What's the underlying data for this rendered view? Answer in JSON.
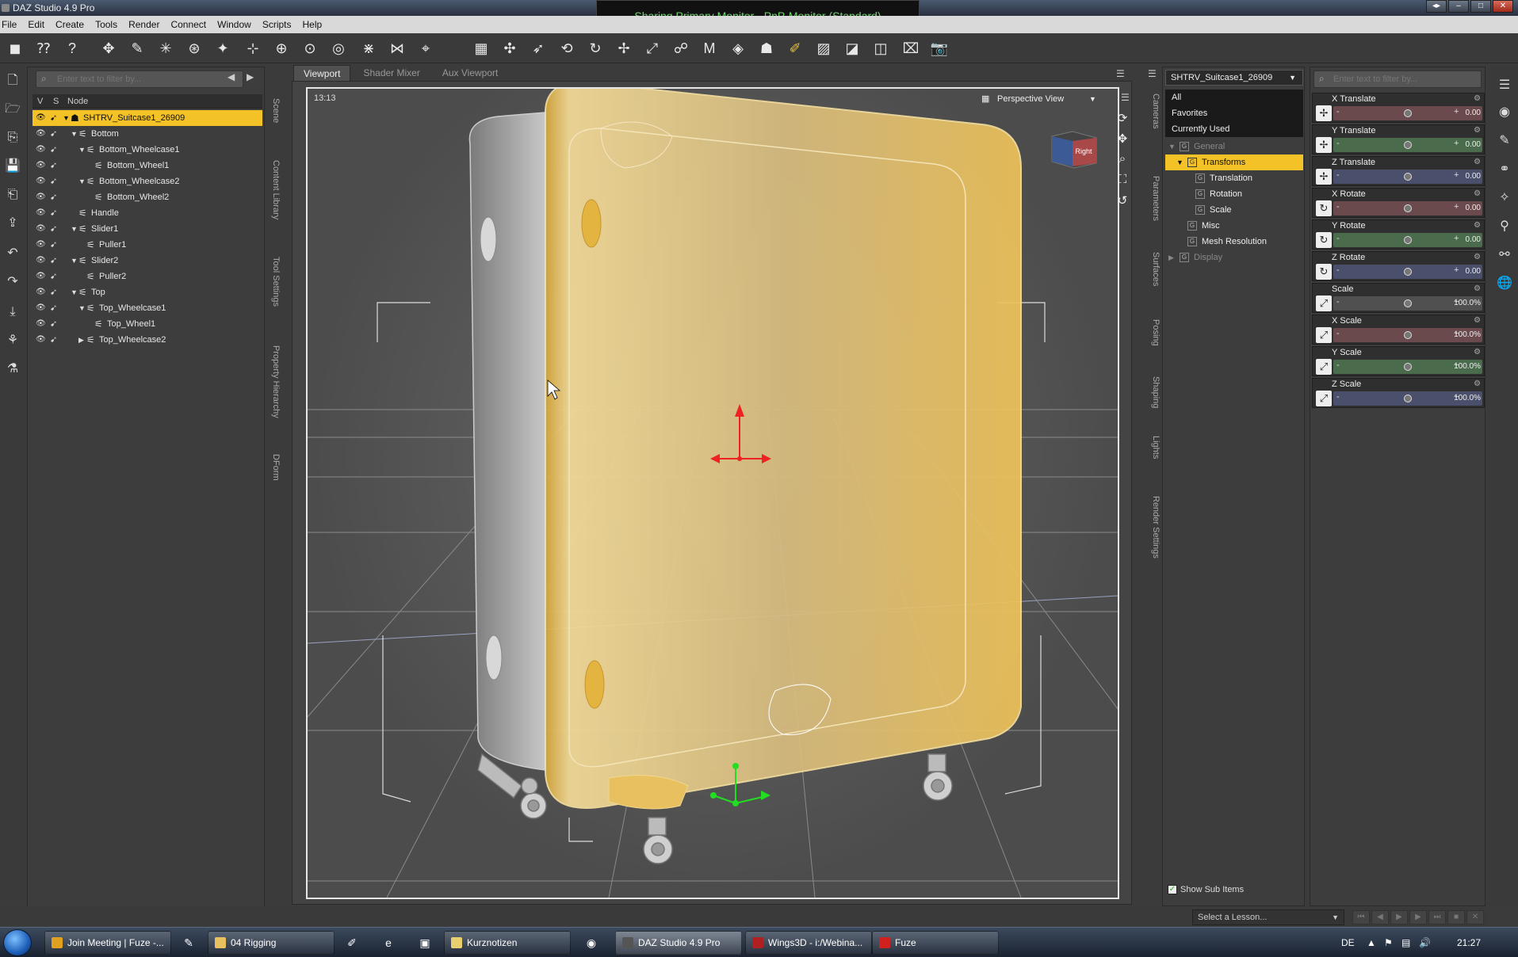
{
  "window": {
    "title": "DAZ Studio 4.9 Pro"
  },
  "share_banner": "Sharing Primary Monitor - PnP-Monitor (Standard)",
  "menu": [
    "File",
    "Edit",
    "Create",
    "Tools",
    "Render",
    "Connect",
    "Window",
    "Scripts",
    "Help"
  ],
  "scene": {
    "filter_placeholder": "Enter text to filter by...",
    "header": {
      "v": "V",
      "s": "S",
      "node": "Node"
    },
    "nodes": [
      {
        "label": "SHTRV_Suitcase1_26909",
        "depth": 0,
        "expanded": true,
        "selected": true,
        "icon": "figure-icon"
      },
      {
        "label": "Bottom",
        "depth": 1,
        "expanded": true
      },
      {
        "label": "Bottom_Wheelcase1",
        "depth": 2,
        "expanded": true
      },
      {
        "label": "Bottom_Wheel1",
        "depth": 3
      },
      {
        "label": "Bottom_Wheelcase2",
        "depth": 2,
        "expanded": true
      },
      {
        "label": "Bottom_Wheel2",
        "depth": 3
      },
      {
        "label": "Handle",
        "depth": 1
      },
      {
        "label": "Slider1",
        "depth": 1,
        "expanded": true
      },
      {
        "label": "Puller1",
        "depth": 2
      },
      {
        "label": "Slider2",
        "depth": 1,
        "expanded": true
      },
      {
        "label": "Puller2",
        "depth": 2
      },
      {
        "label": "Top",
        "depth": 1,
        "expanded": true
      },
      {
        "label": "Top_Wheelcase1",
        "depth": 2,
        "expanded": true
      },
      {
        "label": "Top_Wheel1",
        "depth": 3
      },
      {
        "label": "Top_Wheelcase2",
        "depth": 2,
        "expanded": false
      }
    ]
  },
  "left_side_tabs": [
    "Scene",
    "Content Library",
    "Tool Settings",
    "Property Hierarchy",
    "DForm"
  ],
  "viewport": {
    "tabs": [
      "Viewport",
      "Shader Mixer",
      "Aux Viewport"
    ],
    "active_tab": "Viewport",
    "time": "13:13",
    "view": "Perspective View",
    "cube_label": "Right"
  },
  "right_side_tabs": [
    "Cameras",
    "Parameters",
    "Surfaces",
    "Posing",
    "Shaping",
    "Lights",
    "Render Settings"
  ],
  "parameters": {
    "node": "SHTRV_Suitcase1_26909",
    "filters": [
      "All",
      "Favorites",
      "Currently Used"
    ],
    "groups": [
      {
        "label": "General",
        "depth": 0,
        "expanded": true,
        "dim": true
      },
      {
        "label": "Transforms",
        "depth": 1,
        "expanded": true,
        "selected": true
      },
      {
        "label": "Translation",
        "depth": 2
      },
      {
        "label": "Rotation",
        "depth": 2
      },
      {
        "label": "Scale",
        "depth": 2
      },
      {
        "label": "Misc",
        "depth": 1
      },
      {
        "label": "Mesh Resolution",
        "depth": 1
      },
      {
        "label": "Display",
        "depth": 0,
        "expanded": false,
        "dim": true
      }
    ],
    "show_sub_items": "Show Sub Items"
  },
  "sliders": {
    "filter_placeholder": "Enter text to filter by...",
    "items": [
      {
        "label": "X Translate",
        "value": "0.00",
        "kind": "translate",
        "color": "#6b4a4e",
        "fraction": 0.5
      },
      {
        "label": "Y Translate",
        "value": "0.00",
        "kind": "translate",
        "color": "#4a6b4c",
        "fraction": 0.5
      },
      {
        "label": "Z Translate",
        "value": "0.00",
        "kind": "translate",
        "color": "#4a4f6b",
        "fraction": 0.5
      },
      {
        "label": "X Rotate",
        "value": "0.00",
        "kind": "rotate",
        "color": "#6b4a4e",
        "fraction": 0.5
      },
      {
        "label": "Y Rotate",
        "value": "0.00",
        "kind": "rotate",
        "color": "#4a6b4c",
        "fraction": 0.5
      },
      {
        "label": "Z Rotate",
        "value": "0.00",
        "kind": "rotate",
        "color": "#4a4f6b",
        "fraction": 0.5
      },
      {
        "label": "Scale",
        "value": "100.0%",
        "kind": "scale",
        "color": "#505050",
        "fraction": 0.5
      },
      {
        "label": "X Scale",
        "value": "100.0%",
        "kind": "scale",
        "color": "#6b4a4e",
        "fraction": 0.5
      },
      {
        "label": "Y Scale",
        "value": "100.0%",
        "kind": "scale",
        "color": "#4a6b4c",
        "fraction": 0.5
      },
      {
        "label": "Z Scale",
        "value": "100.0%",
        "kind": "scale",
        "color": "#4a4f6b",
        "fraction": 0.5
      }
    ]
  },
  "lesson": {
    "placeholder": "Select a Lesson..."
  },
  "taskbar": {
    "tasks": [
      {
        "label": "Join Meeting | Fuze -...",
        "color": "#e0a020"
      },
      {
        "label": "04 Rigging",
        "color": "#e8c060"
      },
      {
        "label": "Kurznotizen",
        "color": "#e8d070"
      },
      {
        "label": "DAZ Studio 4.9 Pro",
        "color": "#555555",
        "active": true
      },
      {
        "label": "Wings3D - i:/Webina...",
        "color": "#b02020"
      },
      {
        "label": "Fuze",
        "color": "#d02020"
      }
    ],
    "lang": "DE",
    "clock": "21:27"
  },
  "colors": {
    "accent": "#f2c227",
    "suitcase": "#f0c860",
    "panel": "#3d3d3d"
  }
}
